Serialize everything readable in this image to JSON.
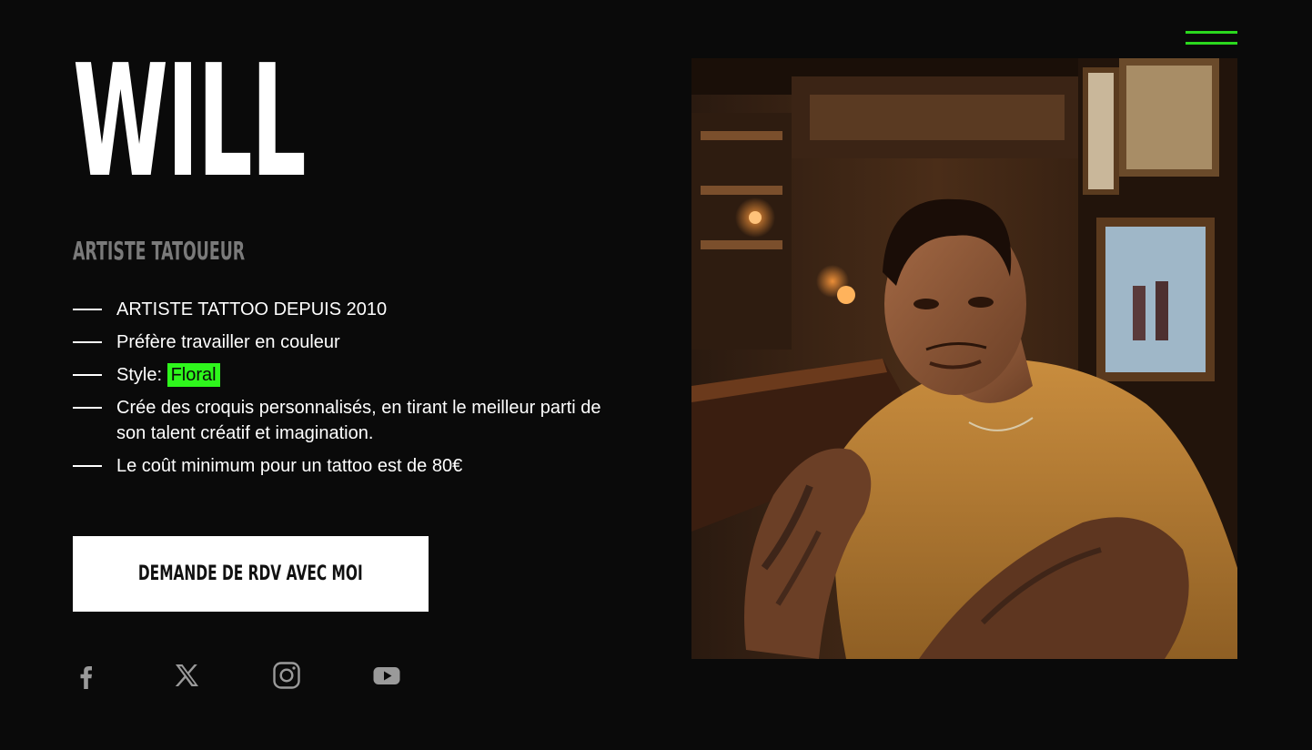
{
  "header": {
    "menu_icon": "hamburger-menu-icon",
    "accent_color": "#2bd91e"
  },
  "hero": {
    "name": "WILL",
    "role": "ARTISTE TATOUEUR",
    "details": [
      "ARTISTE TATTOO DEPUIS 2010",
      "Préfère travailler en couleur",
      "Crée des croquis personnalisés, en tirant le meilleur parti de son talent créatif et imagination.",
      "Le coût minimum pour un tattoo est de 80€"
    ],
    "style_label": "Style:",
    "style_value": "Floral",
    "cta_label": "DEMANDE DE RDV AVEC MOI"
  },
  "social": [
    {
      "icon": "facebook-icon"
    },
    {
      "icon": "x-twitter-icon"
    },
    {
      "icon": "instagram-icon"
    },
    {
      "icon": "youtube-icon"
    }
  ],
  "photo": {
    "subject": "portrait-photo"
  },
  "colors": {
    "background": "#0a0a0a",
    "highlight": "#2ef61c",
    "muted_text": "#7a7a7a"
  }
}
